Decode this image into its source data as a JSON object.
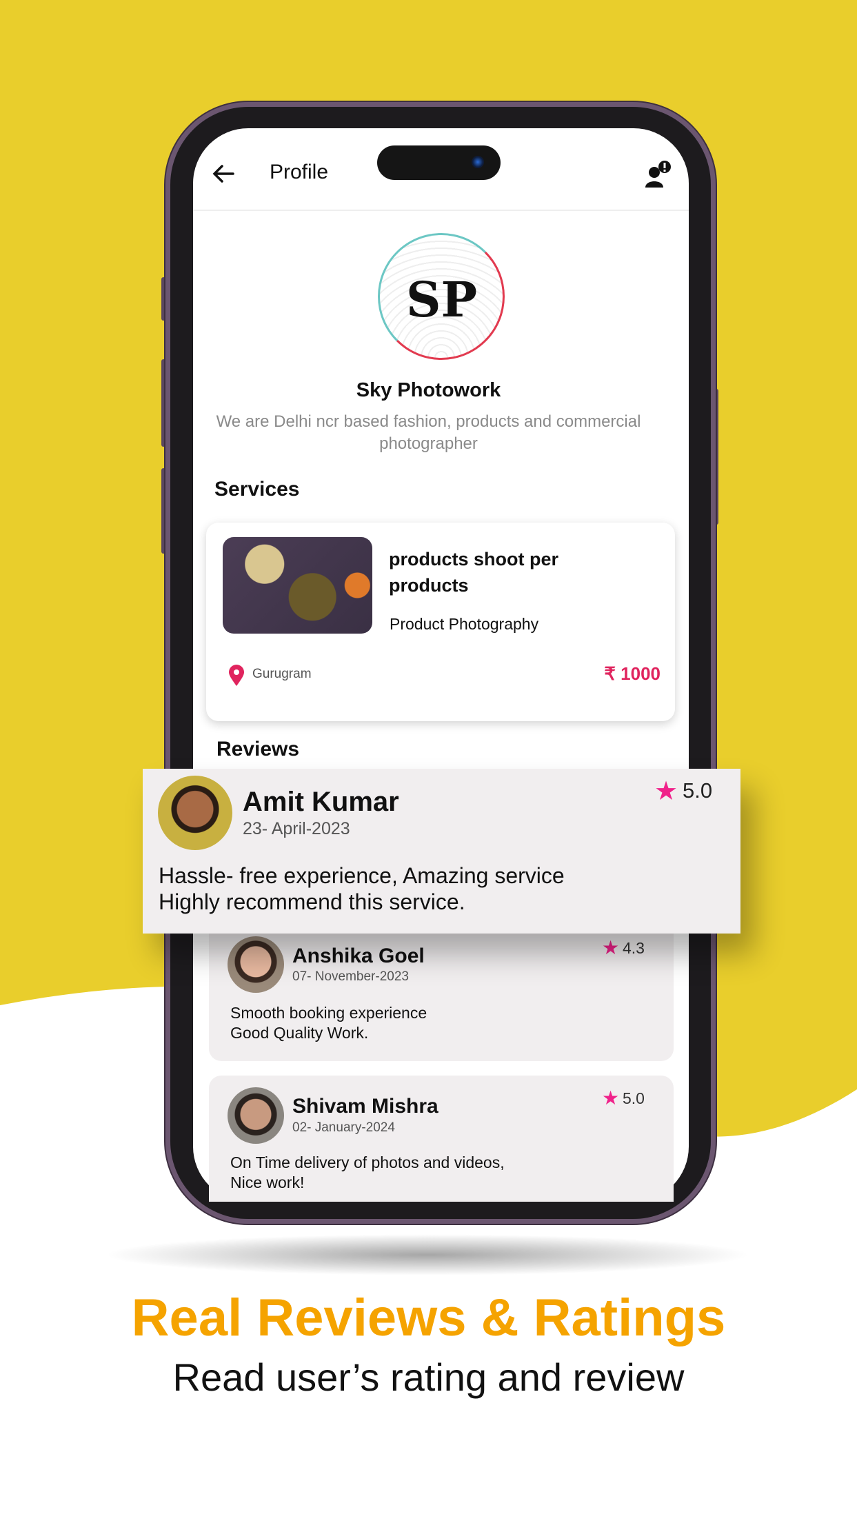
{
  "header": {
    "title": "Profile",
    "back_icon": "arrow-left-icon",
    "account_icon": "user-alert-icon"
  },
  "profile": {
    "logo_text": "SP",
    "name": "Sky Photowork",
    "description_line1": "We are Delhi ncr based fashion, products and commercial",
    "description_line2": "photographer"
  },
  "services": {
    "heading": "Services",
    "items": [
      {
        "title_line1": "products shoot per",
        "title_line2": "products",
        "category": "Product Photography",
        "location": "Gurugram",
        "price": "₹ 1000"
      }
    ]
  },
  "reviews": {
    "heading": "Reviews",
    "items": [
      {
        "name": "Amit Kumar",
        "date": "23- April-2023",
        "rating": "5.0",
        "text_line1": "Hassle- free experience, Amazing service",
        "text_line2": "Highly recommend this service."
      },
      {
        "name": "Anshika Goel",
        "date": "07- November-2023",
        "rating": "4.3",
        "text_line1": "Smooth booking experience",
        "text_line2": "Good Quality Work."
      },
      {
        "name": "Shivam Mishra",
        "date": "02- January-2024",
        "rating": "5.0",
        "text_line1": "On Time delivery of photos and videos,",
        "text_line2": "Nice work!"
      }
    ]
  },
  "promo": {
    "headline": "Real Reviews & Ratings",
    "subtitle": "Read user’s rating and review"
  },
  "colors": {
    "background_yellow": "#E9CE2C",
    "headline_orange": "#F5A300",
    "price_red": "#E0245E",
    "star_pink": "#F0218A",
    "card_gray": "#F1EEEF"
  }
}
